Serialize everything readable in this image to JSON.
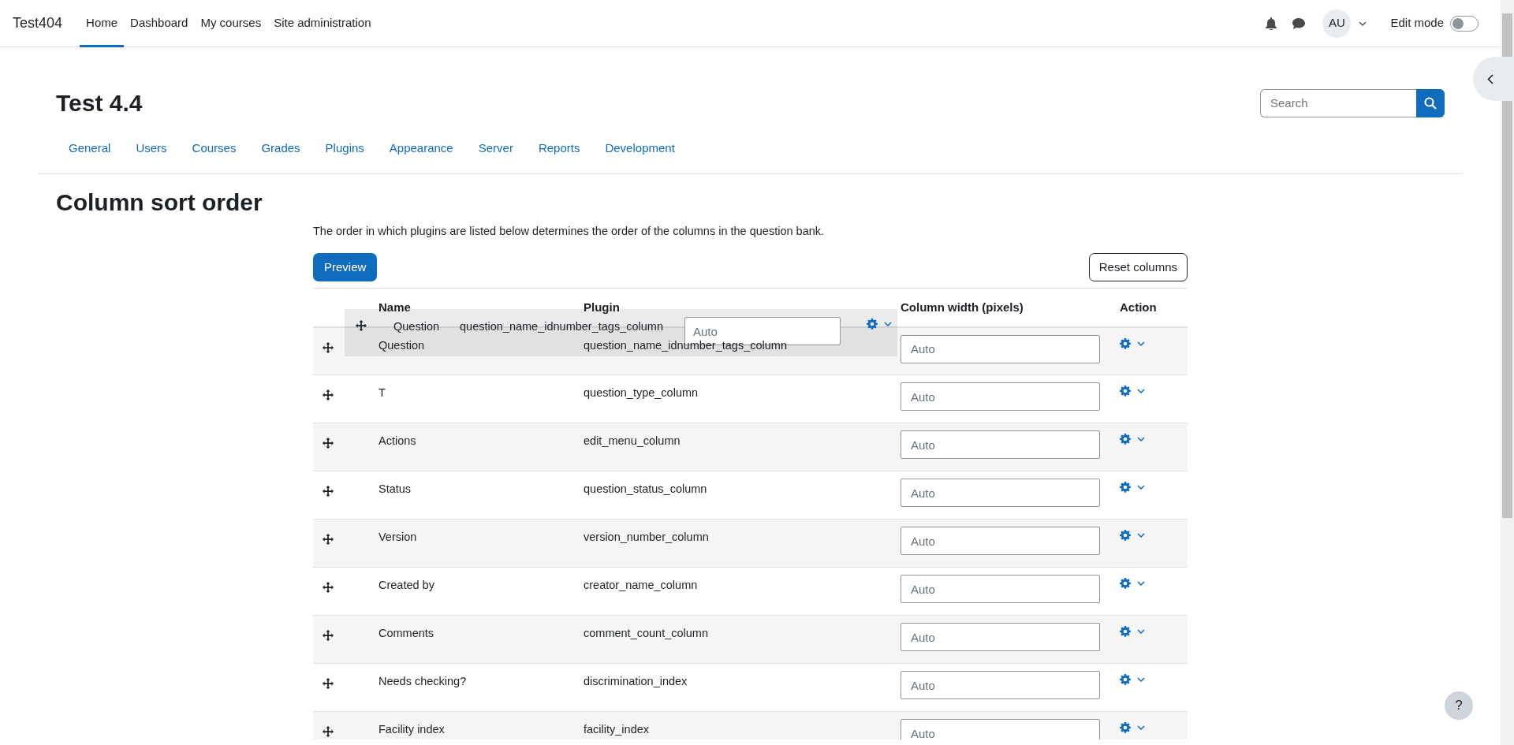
{
  "navbar": {
    "brand": "Test404",
    "items": [
      {
        "label": "Home",
        "selected": true
      },
      {
        "label": "Dashboard",
        "selected": false
      },
      {
        "label": "My courses",
        "selected": false
      },
      {
        "label": "Site administration",
        "selected": false
      }
    ],
    "avatar": "AU",
    "edit_mode": {
      "label": "Edit mode",
      "on": false
    }
  },
  "page_header": {
    "title": "Test 4.4",
    "search": {
      "placeholder": "Search"
    }
  },
  "admin_tabs": [
    "General",
    "Users",
    "Courses",
    "Grades",
    "Plugins",
    "Appearance",
    "Server",
    "Reports",
    "Development"
  ],
  "heading": "Column sort order",
  "description": "The order in which plugins are listed below determines the order of the columns in the question bank.",
  "buttons": {
    "preview": "Preview",
    "reset": "Reset columns"
  },
  "table": {
    "columns": [
      "Name",
      "Plugin",
      "Column width (pixels)",
      "Action"
    ],
    "rows": [
      {
        "name": "Question",
        "plugin": "question_name_idnumber_tags_column",
        "placeholder": "Auto"
      },
      {
        "name": "T",
        "plugin": "question_type_column",
        "placeholder": "Auto"
      },
      {
        "name": "Actions",
        "plugin": "edit_menu_column",
        "placeholder": "Auto"
      },
      {
        "name": "Status",
        "plugin": "question_status_column",
        "placeholder": "Auto"
      },
      {
        "name": "Version",
        "plugin": "version_number_column",
        "placeholder": "Auto"
      },
      {
        "name": "Created by",
        "plugin": "creator_name_column",
        "placeholder": "Auto"
      },
      {
        "name": "Comments",
        "plugin": "comment_count_column",
        "placeholder": "Auto"
      },
      {
        "name": "Needs checking?",
        "plugin": "discrimination_index",
        "placeholder": "Auto"
      },
      {
        "name": "Facility index",
        "plugin": "facility_index",
        "placeholder": "Auto"
      }
    ],
    "dragged_row": {
      "name": "Question",
      "plugin": "question_name_idnumber_tags_column",
      "placeholder": "Auto"
    }
  },
  "help_button": "?"
}
